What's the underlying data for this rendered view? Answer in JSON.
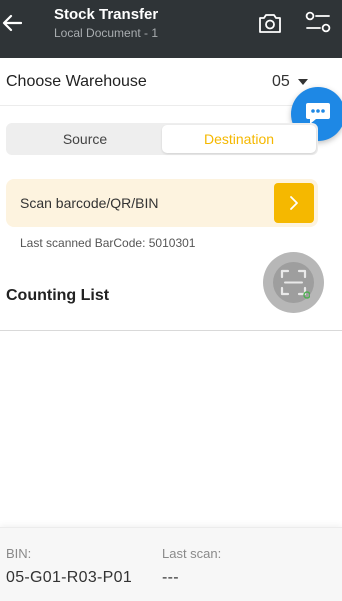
{
  "header": {
    "title": "Stock Transfer",
    "subtitle": "Local Document - 1",
    "icons": {
      "back": "arrow-left-icon",
      "camera": "camera-icon",
      "filter": "filter-icon"
    }
  },
  "warehouse": {
    "label": "Choose Warehouse",
    "value": "05"
  },
  "segment": {
    "source_label": "Source",
    "destination_label": "Destination",
    "selected": "Destination"
  },
  "scan": {
    "placeholder": "Scan barcode/QR/BIN",
    "last_scanned": "Last scanned BarCode: 5010301"
  },
  "counting": {
    "title": "Counting List"
  },
  "footer": {
    "bin_label": "BIN:",
    "bin_value": "05-G01-R03-P01",
    "last_scan_label": "Last scan:",
    "last_scan_value": "---"
  },
  "colors": {
    "appbar": "#2f3437",
    "accent": "#f5b800",
    "chat_fab": "#1e88e5",
    "scan_field_bg": "#fdf3df"
  }
}
